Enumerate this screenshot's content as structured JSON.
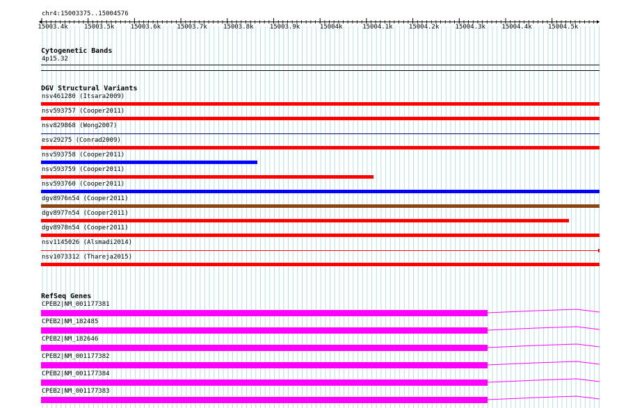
{
  "ruler": {
    "location": "chr4:15003375..15004576",
    "ticks": [
      "15003.4k",
      "15003.5k",
      "15003.6k",
      "15003.7k",
      "15003.8k",
      "15003.9k",
      "15004k",
      "15004.1k",
      "15004.2k",
      "15004.3k",
      "15004.4k",
      "15004.5k"
    ]
  },
  "tracks": {
    "cytoband": {
      "title": "Cytogenetic Bands",
      "label": "4p15.32"
    },
    "dgv": {
      "title": "DGV Structural Variants",
      "items": [
        {
          "label": "nsv461280 (Itsara2009)",
          "color": "#ff0000",
          "extent": 1.0
        },
        {
          "label": "nsv593757 (Cooper2011)",
          "color": "#ff0000",
          "extent": 1.0
        },
        {
          "label": "nsv829868 (Wong2007)",
          "color": "#ff0000",
          "extent": 1.0
        },
        {
          "label": "esv29275 (Conrad2009)",
          "color": "#ff0000",
          "extent": 1.0
        },
        {
          "label": "nsv593758 (Cooper2011)",
          "color": "#0000ff",
          "extent": 0.387
        },
        {
          "label": "nsv593759 (Cooper2011)",
          "color": "#ff0000",
          "extent": 0.595
        },
        {
          "label": "nsv593760 (Cooper2011)",
          "color": "#0000ff",
          "extent": 1.0
        },
        {
          "label": "dgv8976n54 (Cooper2011)",
          "color": "#8b4513",
          "extent": 1.0
        },
        {
          "label": "dgv8977n54 (Cooper2011)",
          "color": "#ff0000",
          "extent": 0.945
        },
        {
          "label": "dgv8978n54 (Cooper2011)",
          "color": "#ff0000",
          "extent": 1.0
        },
        {
          "label": "nsv1145026 (Alsmadi2014)",
          "color": "#ff0000",
          "extent": 1.0
        },
        {
          "label": "nsv1073312 (Thareja2015)",
          "color": "#ff0000",
          "extent": 1.0
        }
      ]
    },
    "refseq": {
      "title": "RefSeq Genes",
      "color": "#ff00ff",
      "items": [
        {
          "label": "CPEB2|NM_001177381",
          "exon_extent": 0.8
        },
        {
          "label": "CPEB2|NM_182485",
          "exon_extent": 0.8
        },
        {
          "label": "CPEB2|NM_182646",
          "exon_extent": 0.8
        },
        {
          "label": "CPEB2|NM_001177382",
          "exon_extent": 0.8
        },
        {
          "label": "CPEB2|NM_001177384",
          "exon_extent": 0.8
        },
        {
          "label": "CPEB2|NM_001177383",
          "exon_extent": 0.8
        }
      ]
    }
  }
}
